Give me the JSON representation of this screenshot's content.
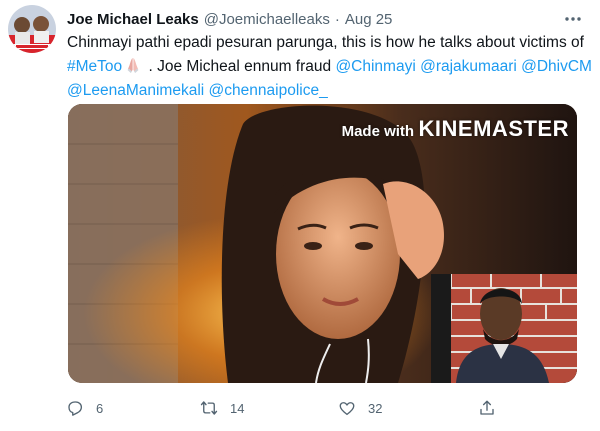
{
  "tweet": {
    "author_name": "Joe Michael Leaks",
    "handle": "@Joemichaelleaks",
    "separator": "·",
    "date": "Aug 25",
    "text_line1": "Chinmayi pathi epadi pesuran parunga, this is how he talks about victims of",
    "hashtag": "#MeToo",
    "emoji": "folded-hands-emoji",
    "text_after_hashtag": " . Joe Micheal ennum fraud ",
    "mentions_line2": [
      "@Chinmayi",
      "@rajakumaari",
      "@DhivCM"
    ],
    "mentions_line3": [
      "@LeenaManimekali",
      "@chennaipolice_"
    ]
  },
  "media": {
    "watermark_prefix": "Made with",
    "watermark_brand": "KINEMASTER"
  },
  "actions": {
    "reply_count": "6",
    "retweet_count": "14",
    "like_count": "32"
  },
  "colors": {
    "link": "#1d9bf0",
    "secondary_text": "#536471",
    "primary_text": "#0f1419"
  },
  "icons": [
    "more-options-icon",
    "reply-icon",
    "retweet-icon",
    "like-icon",
    "share-icon"
  ]
}
